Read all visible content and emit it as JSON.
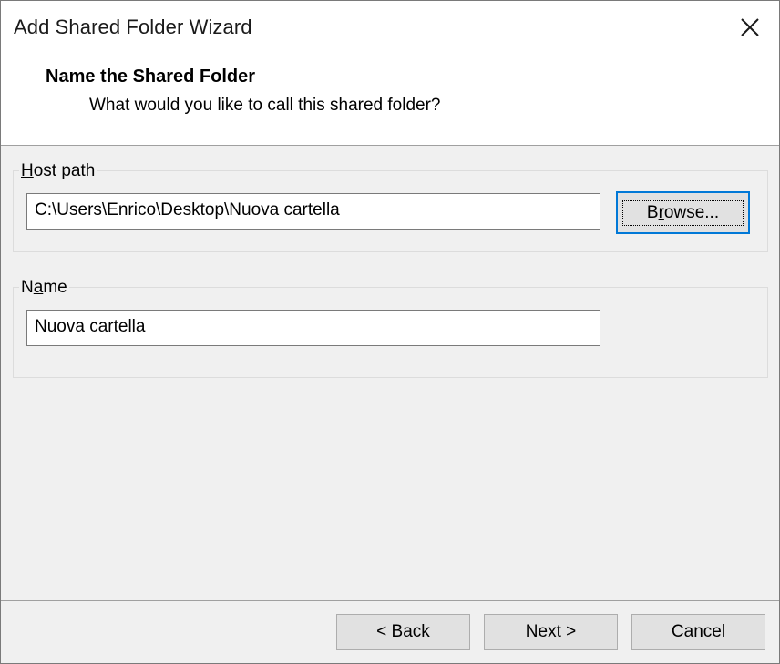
{
  "window": {
    "title": "Add Shared Folder Wizard",
    "close_icon": "close-icon"
  },
  "header": {
    "title": "Name the Shared Folder",
    "subtitle": "What would you like to call this shared folder?"
  },
  "host_path": {
    "label_prefix": "",
    "label_mnemonic": "H",
    "label_rest": "ost path",
    "value": "C:\\Users\\Enrico\\Desktop\\Nuova cartella",
    "browse_prefix": "B",
    "browse_mnemonic": "r",
    "browse_rest": "owse..."
  },
  "name": {
    "label_prefix": "N",
    "label_mnemonic": "a",
    "label_rest": "me",
    "value": "Nuova cartella"
  },
  "footer": {
    "back_prefix": "< ",
    "back_mnemonic": "B",
    "back_rest": "ack",
    "next_prefix": "",
    "next_mnemonic": "N",
    "next_rest": "ext >",
    "cancel_label": "Cancel"
  },
  "colors": {
    "accent": "#0078d7",
    "dialog_bg": "#f0f0f0",
    "header_bg": "#ffffff"
  }
}
